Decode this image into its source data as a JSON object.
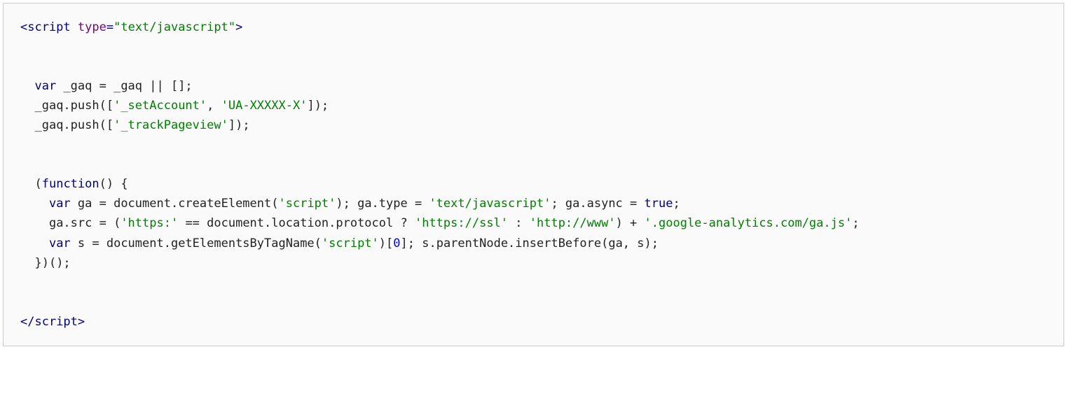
{
  "code": {
    "line1": {
      "open": "<script ",
      "attrname": "type",
      "eq": "=",
      "q1": "\"",
      "attrval": "text/javascript",
      "q2": "\"",
      "close": ">"
    },
    "line_gaq1": {
      "indent": "  ",
      "kw": "var",
      "rest": " _gaq = _gaq || [];"
    },
    "line_gaq2": {
      "indent": "  ",
      "pre": "_gaq.push([",
      "str1": "'_setAccount'",
      "mid": ", ",
      "str2": "'UA-XXXXX-X'",
      "post": "]);"
    },
    "line_gaq3": {
      "indent": "  ",
      "pre": "_gaq.push([",
      "str1": "'_trackPageview'",
      "post": "]);"
    },
    "line_fn_open": {
      "indent": "  ",
      "lparen": "(",
      "kw": "function",
      "rest": "() {"
    },
    "line_ga1": {
      "indent": "    ",
      "kw": "var",
      "p1": " ga = document.createElement(",
      "str1": "'script'",
      "p2": "); ga.type = ",
      "str2": "'text/javascript'",
      "p3": "; ga.async = ",
      "true": "true",
      "p4": ";"
    },
    "line_ga2": {
      "indent": "    ",
      "p1": "ga.src = (",
      "str1": "'https:'",
      "p2": " == document.location.protocol ? ",
      "str2": "'https://ssl'",
      "p3": " : ",
      "str3": "'http://www'",
      "p4": ") + ",
      "str4": "'.google-analytics.com/ga.js'",
      "p5": ";"
    },
    "line_ga3": {
      "indent": "    ",
      "kw": "var",
      "p1": " s = document.getElementsByTagName(",
      "str1": "'script'",
      "p2": ")[",
      "num": "0",
      "p3": "]; s.parentNode.insertBefore(ga, s);"
    },
    "line_fn_close": {
      "indent": "  ",
      "text": "})();"
    },
    "line_end": {
      "text": "</script>"
    }
  }
}
